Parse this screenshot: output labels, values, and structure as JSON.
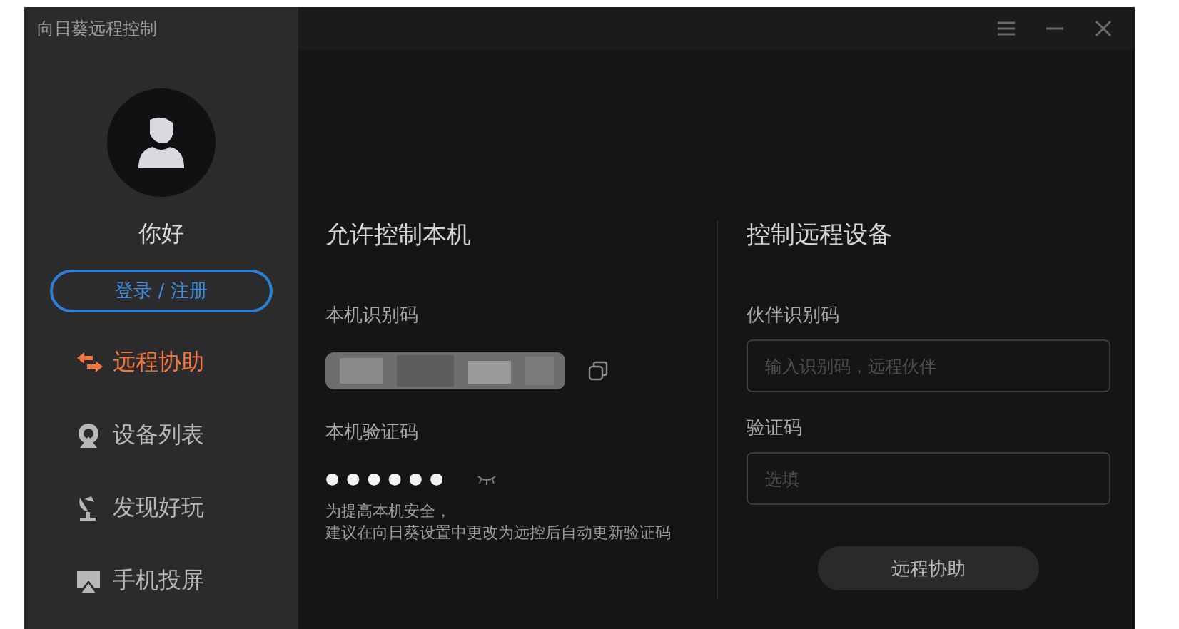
{
  "window": {
    "title": "向日葵远程控制"
  },
  "sidebar": {
    "greeting": "你好",
    "login_button": "登录 / 注册",
    "items": [
      {
        "label": "远程协助",
        "selected": true
      },
      {
        "label": "设备列表",
        "selected": false
      },
      {
        "label": "发现好玩",
        "selected": false
      },
      {
        "label": "手机投屏",
        "selected": false
      }
    ]
  },
  "allow_control": {
    "title": "允许控制本机",
    "id_label": "本机识别码",
    "password_label": "本机验证码",
    "password": "●●●●●●",
    "hint_lines": [
      "为提高本机安全，",
      "建议在向日葵设置中更改为远控后自动更新验证码"
    ]
  },
  "control_remote": {
    "title": "控制远程设备",
    "partner_label": "伙伴识别码",
    "partner_placeholder": "输入识别码，远程伙伴",
    "code_label": "验证码",
    "code_placeholder": "选填",
    "connect_button": "远程协助"
  }
}
